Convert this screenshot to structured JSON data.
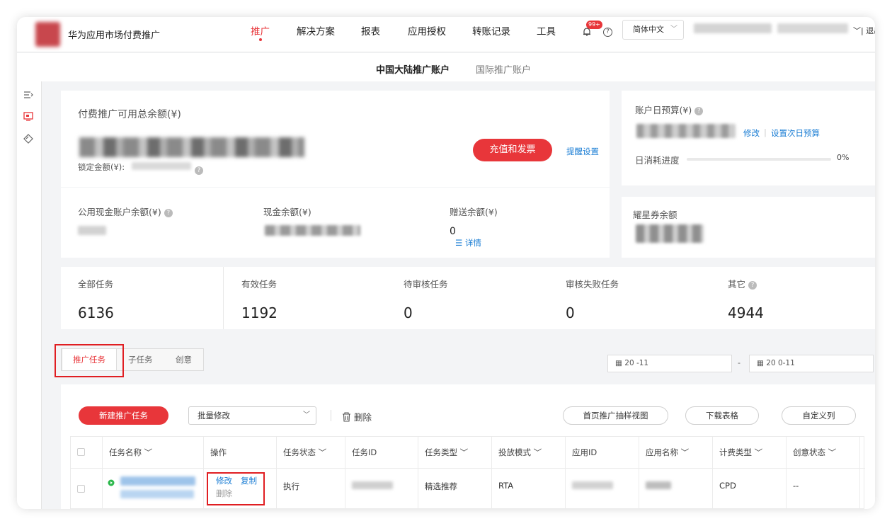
{
  "header": {
    "app_title": "华为应用市场付费推广",
    "nav": [
      "推广",
      "解决方案",
      "报表",
      "应用授权",
      "转账记录",
      "工具"
    ],
    "active_nav": "推广",
    "notif_badge": "99+",
    "help_glyph": "?",
    "language": "简体中文",
    "logout": "| 退出"
  },
  "subnav": {
    "tabs": [
      "中国大陆推广账户",
      "国际推广账户"
    ],
    "active": "中国大陆推广账户"
  },
  "balance": {
    "title": "付费推广可用总余额(¥)",
    "locked_label": "锁定金额(¥):",
    "recharge_button": "充值和发票",
    "reminder_link": "提醒设置",
    "public_cash_label": "公用现金账户余额(¥)",
    "cash_label": "现金余额(¥)",
    "gift_label": "赠送余额(¥)",
    "gift_value": "0",
    "details_link": "详情"
  },
  "budget": {
    "title": "账户日预算(¥)",
    "edit_link": "修改",
    "next_day_link": "设置次日预算",
    "progress_label": "日消耗进度",
    "progress_fraction": 0,
    "progress_text": "0%"
  },
  "coupon": {
    "title": "耀星券余额"
  },
  "stats": [
    {
      "label": "全部任务",
      "value": "6136"
    },
    {
      "label": "有效任务",
      "value": "1192"
    },
    {
      "label": "待审核任务",
      "value": "0"
    },
    {
      "label": "审核失败任务",
      "value": "0"
    },
    {
      "label": "其它",
      "value": "4944"
    }
  ],
  "task_tabs": [
    "推广任务",
    "子任务",
    "创意"
  ],
  "date_range": {
    "start": "20 -11",
    "separator": "-",
    "end": "20 0-11"
  },
  "toolbar": {
    "new_task": "新建推广任务",
    "batch_edit": "批量修改",
    "delete": "删除",
    "sample_view": "首页推广抽样视图",
    "download": "下载表格",
    "custom_columns": "自定义列"
  },
  "table": {
    "columns": [
      "任务名称",
      "操作",
      "任务状态",
      "任务ID",
      "任务类型",
      "投放模式",
      "应用ID",
      "应用名称",
      "计费类型",
      "创意状态"
    ],
    "row": {
      "actions": [
        "修改",
        "复制",
        "删除"
      ],
      "status": "执行",
      "task_type": "精选推荐",
      "delivery_mode": "RTA",
      "billing": "CPD",
      "creative_status": "--"
    }
  },
  "colors": {
    "accent": "#e8363a",
    "link": "#1a7dd4",
    "highlight_box": "#e01e22"
  },
  "icons": [
    "bell-icon",
    "help-icon",
    "chevron-down-icon",
    "menu-collapse-icon",
    "screen-icon",
    "diamond-icon",
    "calendar-icon",
    "trash-icon",
    "list-icon",
    "play-icon"
  ]
}
